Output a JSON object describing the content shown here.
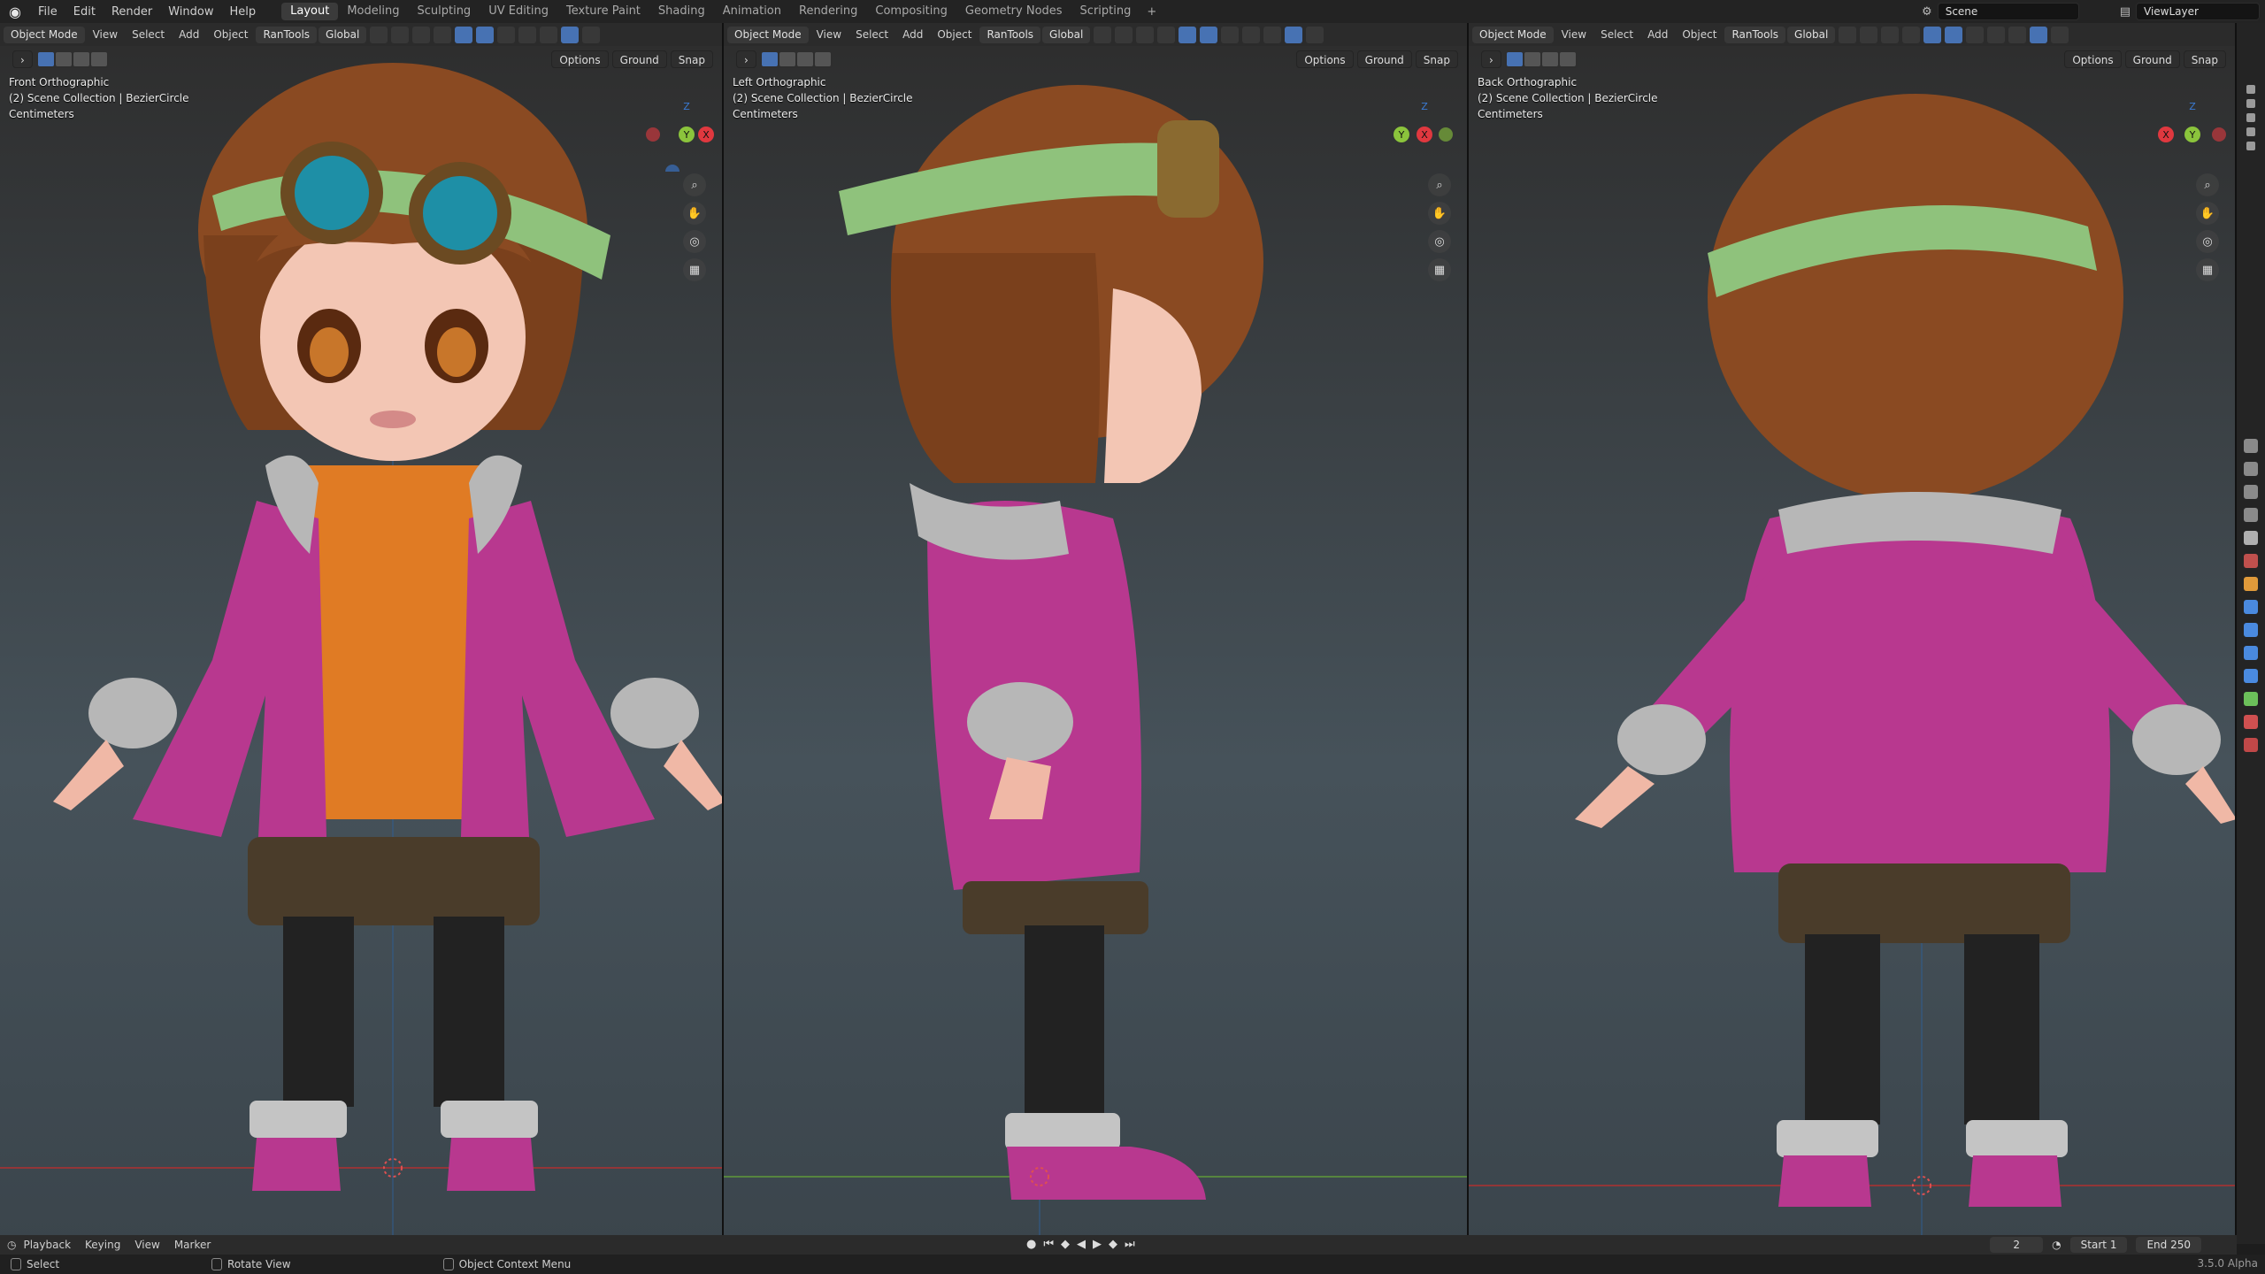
{
  "menubar": {
    "menus": [
      "File",
      "Edit",
      "Render",
      "Window",
      "Help"
    ],
    "workspaces": [
      "Layout",
      "Modeling",
      "Sculpting",
      "UV Editing",
      "Texture Paint",
      "Shading",
      "Animation",
      "Rendering",
      "Compositing",
      "Geometry Nodes",
      "Scripting"
    ],
    "active_workspace": "Layout",
    "scene": "Scene",
    "view_layer": "ViewLayer"
  },
  "viewports": [
    {
      "mode": "Object Mode",
      "menus": [
        "View",
        "Select",
        "Add",
        "Object",
        "RanTools"
      ],
      "orientation": "Global",
      "options": "Options",
      "ground": "Ground",
      "snap": "Snap",
      "view_name": "Front Orthographic",
      "collection": "(2) Scene Collection | BezierCircle",
      "units": "Centimeters"
    },
    {
      "mode": "Object Mode",
      "menus": [
        "View",
        "Select",
        "Add",
        "Object",
        "RanTools"
      ],
      "orientation": "Global",
      "options": "Options",
      "ground": "Ground",
      "snap": "Snap",
      "view_name": "Left Orthographic",
      "collection": "(2) Scene Collection | BezierCircle",
      "units": "Centimeters"
    },
    {
      "mode": "Object Mode",
      "menus": [
        "View",
        "Select",
        "Add",
        "Object",
        "RanTools"
      ],
      "orientation": "Global",
      "options": "Options",
      "ground": "Ground",
      "snap": "Snap",
      "view_name": "Back Orthographic",
      "collection": "(2) Scene Collection | BezierCircle",
      "units": "Centimeters"
    }
  ],
  "gizmo_axes": {
    "z": "Z",
    "y": "Y",
    "x": "X"
  },
  "colors": {
    "jacket": "#b8388f",
    "sweater": "#e07b24",
    "hair": "#8a4a22",
    "goggles": "#1e8fa6",
    "band": "#8fc27c",
    "x_axis": "#e0383f",
    "y_axis": "#8bc43c",
    "z_axis": "#3a7bd5",
    "accent": "#4772b3"
  },
  "timeline": {
    "menus": [
      "Playback",
      "Keying",
      "View",
      "Marker"
    ],
    "current_frame": "2",
    "start_label": "Start",
    "start": "1",
    "end_label": "End",
    "end": "250"
  },
  "statusbar": {
    "select": "Select",
    "rotate": "Rotate View",
    "context": "Object Context Menu",
    "version": "3.5.0 Alpha"
  }
}
